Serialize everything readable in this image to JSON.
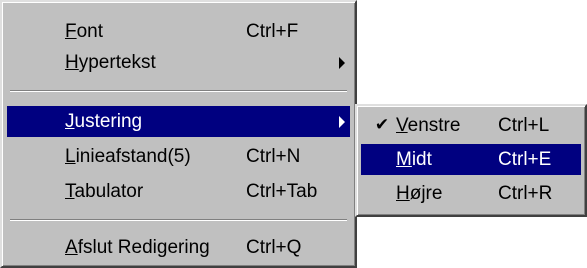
{
  "main_menu": {
    "items": [
      {
        "label_ul": "F",
        "label_rest": "ont",
        "shortcut": "Ctrl+F"
      },
      {
        "label_ul": "H",
        "label_rest": "ypertekst",
        "shortcut": ""
      },
      {
        "label_ul": "J",
        "label_rest": "ustering",
        "shortcut": ""
      },
      {
        "label_ul": "L",
        "label_rest": "inieafstand(5)",
        "shortcut": "Ctrl+N"
      },
      {
        "label_ul": "T",
        "label_rest": "abulator",
        "shortcut": "Ctrl+Tab"
      },
      {
        "label_ul": "A",
        "label_rest": "fslut Redigering",
        "shortcut": "Ctrl+Q"
      }
    ],
    "submenu_arrow": "triangle-right-icon"
  },
  "sub_menu": {
    "items": [
      {
        "label_ul": "V",
        "label_rest": "enstre",
        "shortcut": "Ctrl+L",
        "checked": true
      },
      {
        "label_ul": "M",
        "label_rest": "idt",
        "shortcut": "Ctrl+E",
        "checked": false
      },
      {
        "label_ul": "H",
        "label_rest": "øjre",
        "shortcut": "Ctrl+R",
        "checked": false
      }
    ],
    "check_glyph": "✔"
  },
  "colors": {
    "menu_background": "#c0c0c0",
    "highlight_background": "#000080",
    "highlight_text": "#ffffff"
  }
}
